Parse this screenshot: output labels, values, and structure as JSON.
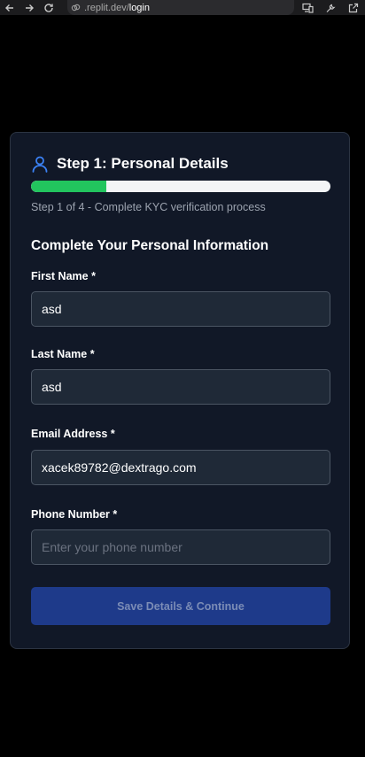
{
  "browser": {
    "url_host": ".replit.dev/",
    "url_path": "login",
    "icons": [
      "back-icon",
      "forward-icon",
      "reload-icon",
      "lock-icon",
      "devices-icon",
      "tools-icon",
      "open-external-icon"
    ]
  },
  "card": {
    "title": "Step 1: Personal Details",
    "progress": 0.25,
    "progress_caption": "Step 1 of 4 - Complete KYC verification process",
    "section_title": "Complete Your Personal Information"
  },
  "form": {
    "first_name": {
      "label": "First Name *",
      "value": "asd",
      "placeholder": ""
    },
    "last_name": {
      "label": "Last Name *",
      "value": "asd",
      "placeholder": ""
    },
    "email": {
      "label": "Email Address *",
      "value": "xacek89782@dextrago.com",
      "placeholder": ""
    },
    "phone": {
      "label": "Phone Number *",
      "value": "",
      "placeholder": "Enter your phone number"
    },
    "submit_label": "Save Details & Continue"
  },
  "colors": {
    "background": "#000000",
    "card": "#111827",
    "input": "#1f2937",
    "progress": "#22c55e",
    "accent": "#3b82f6",
    "button": "#1e3a8a"
  }
}
